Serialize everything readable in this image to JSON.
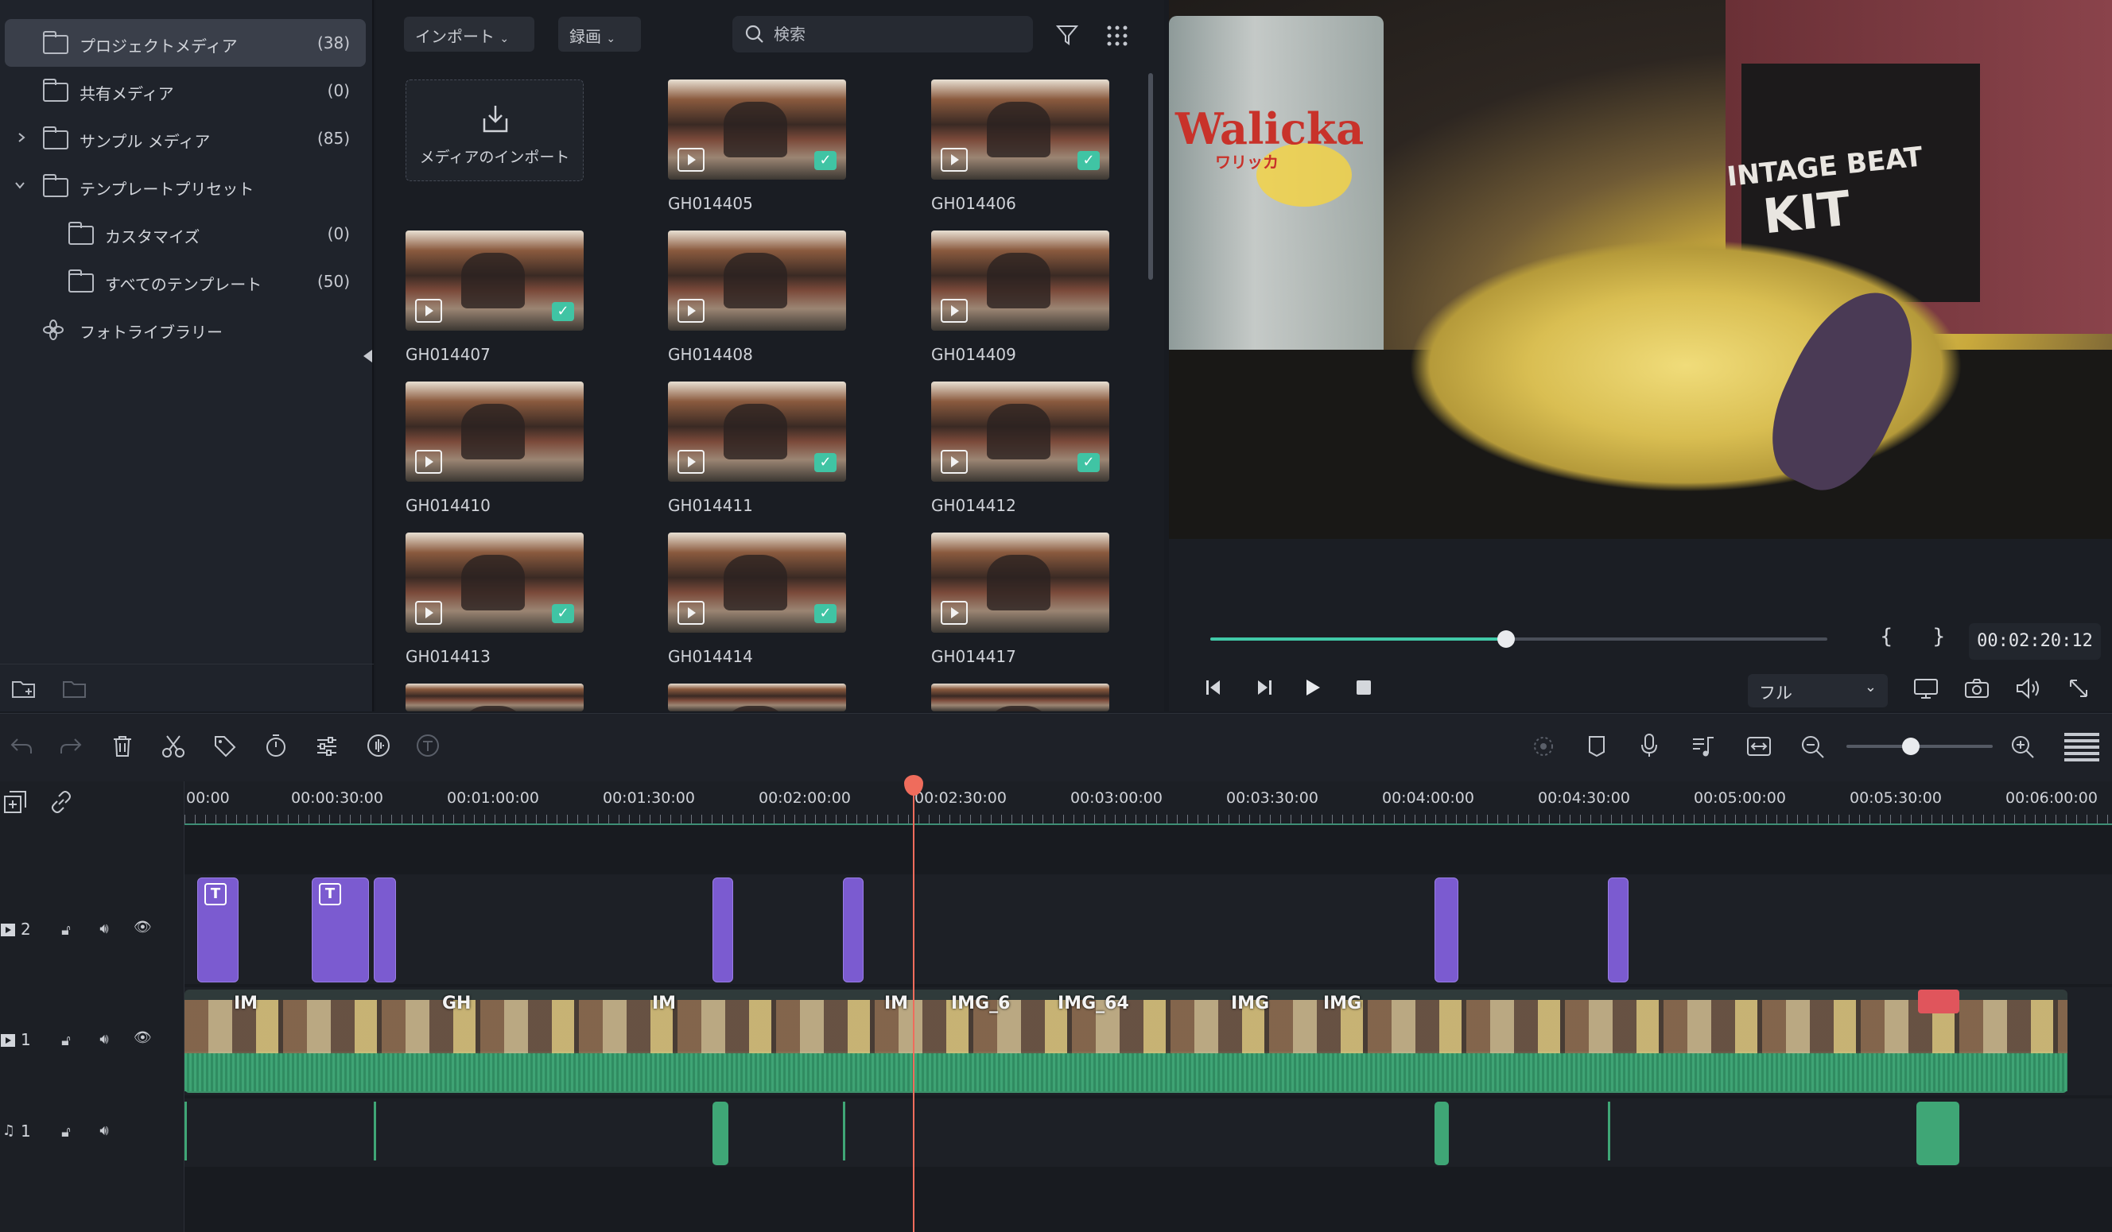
{
  "library": {
    "items": [
      {
        "label": "プロジェクトメディア",
        "count": "(38)"
      },
      {
        "label": "共有メディア",
        "count": "(0)"
      },
      {
        "label": "サンプル メディア",
        "count": "(85)"
      },
      {
        "label": "テンプレートプリセット",
        "count": ""
      },
      {
        "label": "カスタマイズ",
        "count": "(0)"
      },
      {
        "label": "すべてのテンプレート",
        "count": "(50)"
      },
      {
        "label": "フォトライブラリー",
        "count": ""
      }
    ]
  },
  "media_toolbar": {
    "import_label": "インポート",
    "record_label": "録画",
    "search_placeholder": "検索"
  },
  "media": {
    "import_tile_label": "メディアのインポート",
    "clips": [
      "GH014405",
      "GH014406",
      "GH014407",
      "GH014408",
      "GH014409",
      "GH014410",
      "GH014411",
      "GH014412",
      "GH014413",
      "GH014414",
      "GH014417"
    ]
  },
  "preview": {
    "brand_text": "Walicka",
    "brand_sub": "ワリッカ",
    "shirt_text": "INTAGE BEAT",
    "shirt_text2": "KIT"
  },
  "player": {
    "progress": 0.48,
    "timecode": "00:02:20:12",
    "mark_in": "{",
    "mark_out": "}",
    "quality": "フル"
  },
  "timeline": {
    "ruler": [
      "00:00",
      "00:00:30:00",
      "00:01:00:00",
      "00:01:30:00",
      "00:02:00:00",
      "00:02:30:00",
      "00:03:00:00",
      "00:03:30:00",
      "00:04:00:00",
      "00:04:30:00",
      "00:05:00:00",
      "00:05:30:00",
      "00:06:00:00"
    ],
    "tracks": [
      {
        "label": "2"
      },
      {
        "label": "1"
      },
      {
        "label": "1"
      }
    ],
    "clip_names": [
      "IM",
      "GH",
      "IM",
      "IM",
      "IMG_6",
      "IMG_64",
      "IMG",
      "IMG"
    ]
  },
  "colors": {
    "accent": "#41c9a8",
    "title_clip": "#7b5bd0",
    "playhead": "#ef6c5c"
  }
}
